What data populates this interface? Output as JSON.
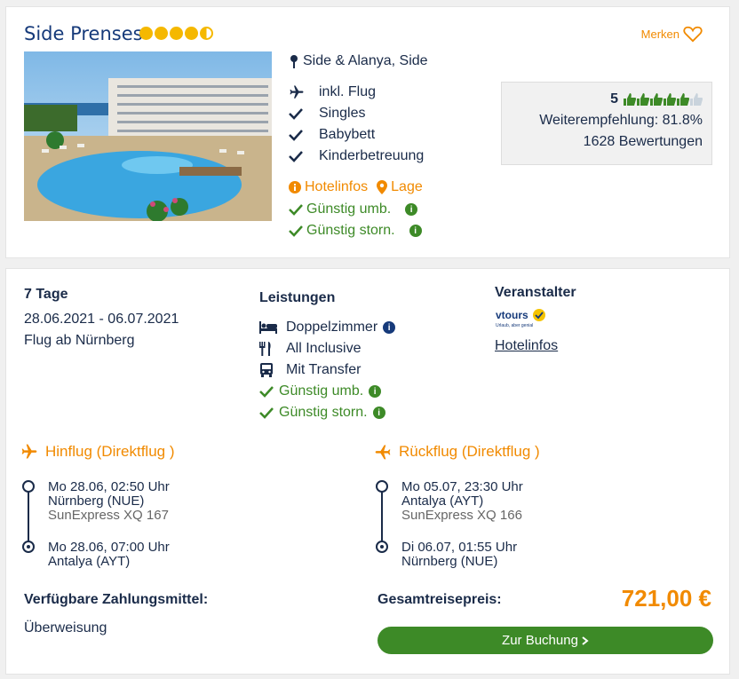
{
  "hotel": {
    "name": "Side Prenses",
    "stars": 4.5,
    "merken_label": "Merken",
    "location": "Side & Alanya, Side",
    "features": [
      "inkl. Flug",
      "Singles",
      "Babybett",
      "Kinderbetreuung"
    ],
    "hotelinfos_label": "Hotelinfos",
    "lage_label": "Lage",
    "guenstig_umb": "Günstig umb.",
    "guenstig_storn": "Günstig storn."
  },
  "rating": {
    "score": "5",
    "thumbs_filled": 5.5,
    "thumbs_total": 6,
    "recommendation": "Weiterempfehlung: 81.8%",
    "reviews": "1628 Bewertungen"
  },
  "offer": {
    "days": "7 Tage",
    "dates": "28.06.2021 - 06.07.2021",
    "flight_from": "Flug ab Nürnberg",
    "leistungen_title": "Leistungen",
    "leistungen": {
      "room": "Doppelzimmer",
      "board": "All Inclusive",
      "transfer": "Mit Transfer",
      "umb": "Günstig umb.",
      "storn": "Günstig storn."
    },
    "veranstalter_title": "Veranstalter",
    "veranstalter_logo_text": "vtours",
    "veranstalter_logo_tagline": "Urlaub, aber genial",
    "veranstalter_link": "Hotelinfos"
  },
  "hinflug": {
    "title": "Hinflug (Direktflug )",
    "dep_time": "Mo 28.06, 02:50 Uhr",
    "dep_airport": "Nürnberg (NUE)",
    "airline": "SunExpress XQ 167",
    "arr_time": "Mo 28.06, 07:00 Uhr",
    "arr_airport": "Antalya (AYT)"
  },
  "rueckflug": {
    "title": "Rückflug (Direktflug )",
    "dep_time": "Mo 05.07, 23:30 Uhr",
    "dep_airport": "Antalya (AYT)",
    "airline": "SunExpress XQ 166",
    "arr_time": "Di 06.07, 01:55 Uhr",
    "arr_airport": "Nürnberg (NUE)"
  },
  "payment": {
    "title": "Verfügbare Zahlungsmittel:",
    "method": "Überweisung"
  },
  "total": {
    "label": "Gesamtreisepreis:",
    "price": "721,00 €",
    "button": "Zur Buchung"
  },
  "colors": {
    "navy": "#1a2b49",
    "orange": "#f18a00",
    "green": "#3d8a27",
    "star": "#f5b800"
  }
}
